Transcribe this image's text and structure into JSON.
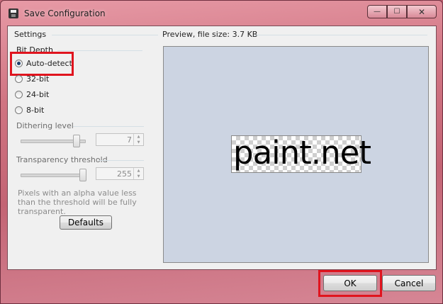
{
  "window": {
    "title": "Save Configuration",
    "controls": {
      "minimize": "—",
      "maximize": "☐",
      "close": "✕"
    }
  },
  "settings": {
    "header": "Settings",
    "bit_depth": {
      "label": "Bit Depth",
      "options": [
        {
          "label": "Auto-detect",
          "checked": true
        },
        {
          "label": "32-bit",
          "checked": false
        },
        {
          "label": "24-bit",
          "checked": false
        },
        {
          "label": "8-bit",
          "checked": false
        }
      ]
    },
    "dithering": {
      "label": "Dithering level",
      "value": "7"
    },
    "transparency": {
      "label": "Transparency threshold",
      "value": "255"
    },
    "help_text": "Pixels with an alpha value less than the threshold will be fully transparent.",
    "defaults_button": "Defaults"
  },
  "preview": {
    "header": "Preview, file size: 3.7 KB",
    "logo_text": "paint.net"
  },
  "buttons": {
    "ok": "OK",
    "cancel": "Cancel"
  },
  "colors": {
    "highlight": "#e0141e"
  }
}
